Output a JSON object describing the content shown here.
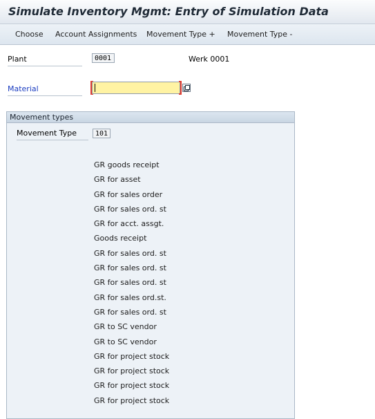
{
  "window": {
    "title": "Simulate Inventory Mgmt: Entry of Simulation Data"
  },
  "toolbar": {
    "buttons": [
      "Choose",
      "Account Assignments",
      "Movement Type +",
      "Movement Type -"
    ]
  },
  "header_fields": {
    "plant_label": "Plant",
    "plant_value": "0001",
    "plant_description": "Werk 0001",
    "material_label": "Material",
    "material_value": ""
  },
  "movement_types": {
    "group_title": "Movement types",
    "movement_type_label": "Movement Type",
    "movement_type_value": "101",
    "descriptions": [
      "GR goods receipt",
      "GR for asset",
      "GR for sales order",
      "GR for sales ord. st",
      "GR for acct. assgt.",
      "Goods receipt",
      "GR for sales ord. st",
      "GR for sales ord. st",
      "GR for sales ord. st",
      "GR for sales ord.st.",
      "GR for sales ord. st",
      "GR to SC vendor",
      "GR to SC vendor",
      "GR for project stock",
      "GR for project stock",
      "GR for project stock",
      "GR for project stock"
    ]
  },
  "icons": {
    "value_help": "value-help-icon"
  },
  "colors": {
    "required_marker": "#e03b2f",
    "material_input_bg": "#fff3a3",
    "material_label": "#1a3cc0"
  }
}
